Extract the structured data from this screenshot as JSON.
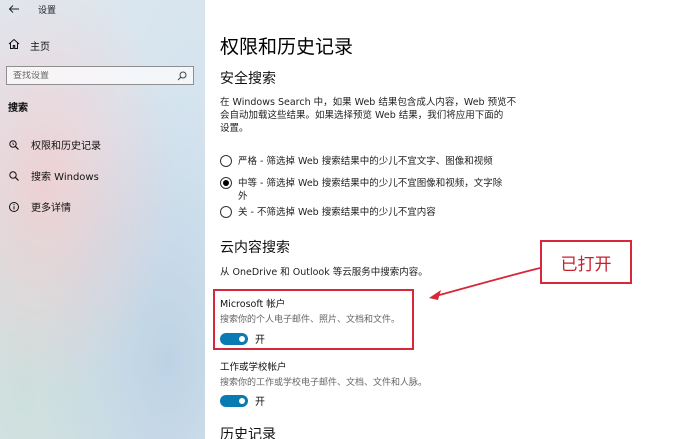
{
  "window": {
    "title": "设置"
  },
  "sidebar": {
    "home_label": "主页",
    "search_placeholder": "查找设置",
    "section_title": "搜索",
    "items": [
      {
        "label": "权限和历史记录",
        "icon": "permissions-icon"
      },
      {
        "label": "搜索 Windows",
        "icon": "search-icon"
      },
      {
        "label": "更多详情",
        "icon": "info-icon"
      }
    ]
  },
  "main": {
    "page_title": "权限和历史记录",
    "safe_search": {
      "title": "安全搜索",
      "description_lines": [
        "在 Windows Search 中，如果 Web 结果包含成人内容，Web 预览不",
        "会自动加载这些结果。如果选择预览 Web 结果，我们将应用下面的",
        "设置。"
      ],
      "options": [
        {
          "lines": [
            "严格 - 筛选掉 Web 搜索结果中的少儿不宜文字、图像和视频"
          ],
          "selected": false
        },
        {
          "lines": [
            "中等 - 筛选掉 Web 搜索结果中的少儿不宜图像和视频，文字除",
            "外"
          ],
          "selected": true
        },
        {
          "lines": [
            "关 - 不筛选掉 Web 搜索结果中的少儿不宜内容"
          ],
          "selected": false
        }
      ]
    },
    "cloud_search": {
      "title": "云内容搜索",
      "description": "从 OneDrive 和 Outlook 等云服务中搜索内容。",
      "microsoft_account": {
        "title": "Microsoft 帐户",
        "description": "搜索你的个人电子邮件、照片、文档和文件。",
        "state_label": "开"
      },
      "work_account": {
        "title": "工作或学校帐户",
        "description": "搜索你的工作或学校电子邮件、文档、文件和人脉。",
        "state_label": "开"
      }
    },
    "history": {
      "title": "历史记录"
    }
  },
  "annotation": {
    "callout_text": "已打开",
    "color": "#d6283a"
  },
  "colors": {
    "accent": "#0a7ab3"
  }
}
